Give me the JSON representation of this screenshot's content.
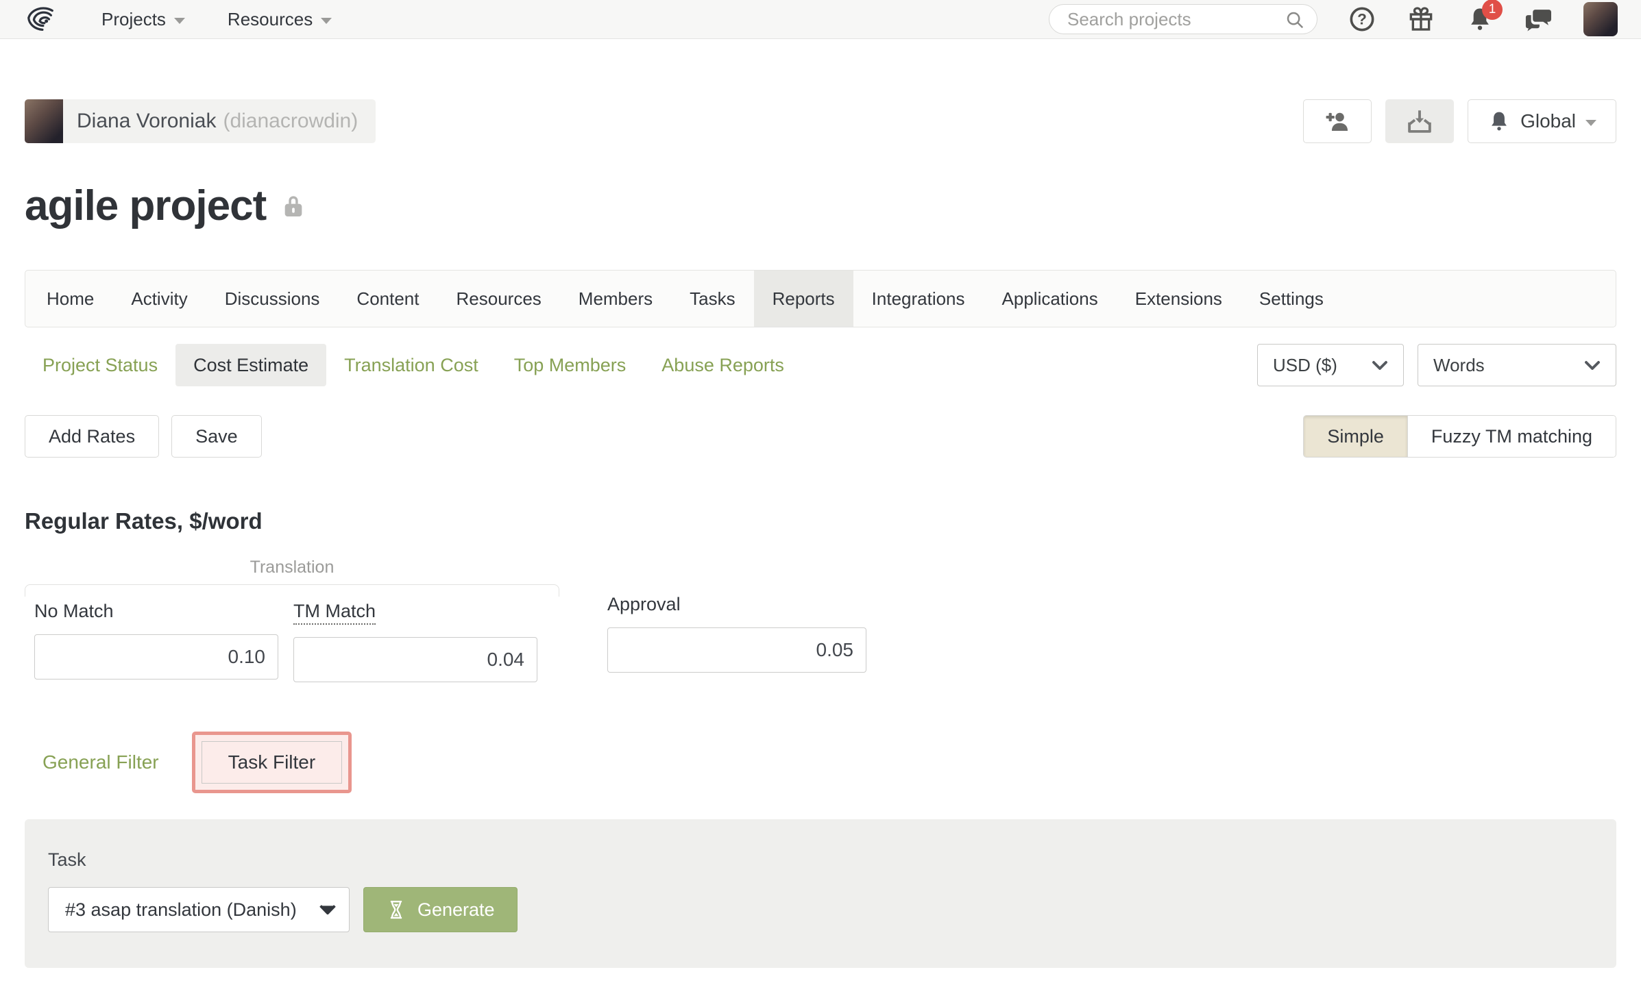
{
  "navbar": {
    "menus": [
      {
        "label": "Projects"
      },
      {
        "label": "Resources"
      }
    ],
    "search_placeholder": "Search projects",
    "notification_count": "1"
  },
  "user": {
    "name": "Diana Voroniak",
    "username": "(dianacrowdin)"
  },
  "header_actions": {
    "global_label": "Global"
  },
  "page": {
    "title": "agile project"
  },
  "tabs": {
    "items": [
      "Home",
      "Activity",
      "Discussions",
      "Content",
      "Resources",
      "Members",
      "Tasks",
      "Reports",
      "Integrations",
      "Applications",
      "Extensions",
      "Settings"
    ],
    "active": "Reports"
  },
  "report_tabs": {
    "items": [
      "Project Status",
      "Cost Estimate",
      "Translation Cost",
      "Top Members",
      "Abuse Reports"
    ],
    "active": "Cost Estimate"
  },
  "selectors": {
    "currency": "USD ($)",
    "unit": "Words"
  },
  "actions": {
    "add_rates": "Add Rates",
    "save": "Save"
  },
  "mode_toggle": {
    "options": [
      "Simple",
      "Fuzzy TM matching"
    ],
    "active": "Simple"
  },
  "rates": {
    "heading": "Regular Rates, $/word",
    "group_label": "Translation",
    "fields": [
      {
        "label": "No Match",
        "value": "0.10"
      },
      {
        "label": "TM Match",
        "value": "0.04"
      },
      {
        "label": "Approval",
        "value": "0.05"
      }
    ]
  },
  "filters": {
    "general": "General Filter",
    "task": "Task Filter"
  },
  "task_panel": {
    "label": "Task",
    "selected_task": "#3 asap translation (Danish)",
    "generate_label": "Generate"
  },
  "colors": {
    "link_green": "#87a154",
    "generate_green": "#9fb678",
    "highlight_red": "#e9968e",
    "highlight_pink_bg": "#fcecea",
    "badge_red": "#e04f47",
    "active_tab_bg": "#e9e9e6",
    "simple_toggle_bg": "#ebe5d3"
  }
}
